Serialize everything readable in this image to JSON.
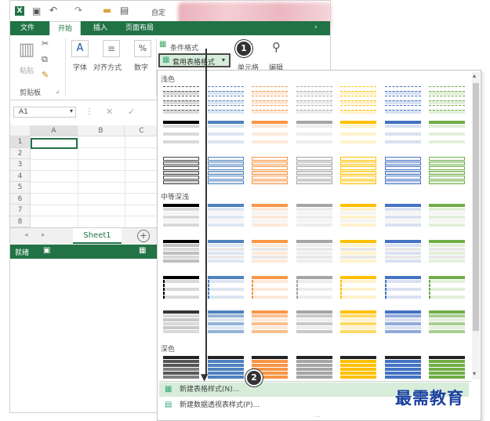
{
  "titlebar": {
    "filename": "自定"
  },
  "tabs": [
    {
      "label": "文件"
    },
    {
      "label": "开始"
    },
    {
      "label": "插入"
    },
    {
      "label": "页面布局"
    }
  ],
  "ribbon": {
    "clipboard_label": "剪贴板",
    "paste_label": "粘贴",
    "font_label": "字体",
    "align_label": "对齐方式",
    "number_label": "数字",
    "percent_glyph": "%",
    "conditional_format_label": "条件格式",
    "table_format_label": "套用表格格式",
    "cells_label": "单元格",
    "edit_label": "编辑"
  },
  "formula_bar": {
    "name_box": "A1"
  },
  "grid": {
    "columns": [
      "A",
      "B",
      "C"
    ],
    "rows": [
      "1",
      "2",
      "3",
      "4",
      "5",
      "6",
      "7",
      "8"
    ]
  },
  "sheet_tab": "Sheet1",
  "status": {
    "ready": "就绪"
  },
  "gallery": {
    "sections": [
      "浅色",
      "中等深浅",
      "深色"
    ],
    "menu_new_table_style": "新建表格样式(N)...",
    "menu_new_pivot_style": "新建数据透视表样式(P)...",
    "colors": [
      "#000000",
      "#4f81bd",
      "#f79646",
      "#a5a5a5",
      "#ffc000",
      "#4472c4",
      "#70ad47"
    ],
    "light_colors": [
      "#d9d9d9",
      "#dce6f1",
      "#fde9d9",
      "#ededed",
      "#fff2cc",
      "#d9e1f2",
      "#e2efda"
    ]
  },
  "callouts": [
    "1",
    "2"
  ],
  "watermark": "最需教育"
}
